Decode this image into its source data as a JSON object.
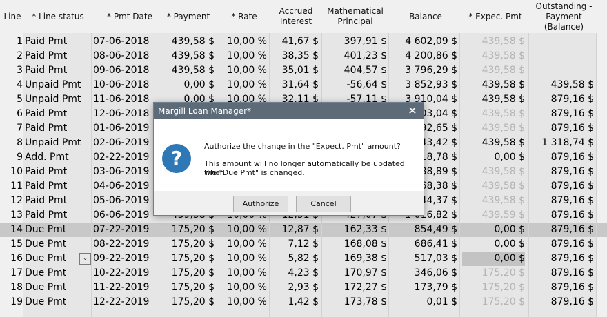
{
  "columns": [
    "Line",
    "* Line status",
    "* Pmt Date",
    "* Payment",
    "* Rate",
    "Accrued Interest",
    "Mathematical Principal",
    "Balance",
    "* Expec. Pmt",
    "Outstanding - Payment (Balance)"
  ],
  "rows": [
    {
      "line": "1",
      "status": "Paid Pmt",
      "date": "07-06-2018",
      "payment": "439,58 $",
      "rate": "10,00 %",
      "interest": "41,67 $",
      "principal": "397,91 $",
      "balance": "4 602,09 $",
      "expec": "439,58 $",
      "outstanding": ""
    },
    {
      "line": "2",
      "status": "Paid Pmt",
      "date": "08-06-2018",
      "payment": "439,58 $",
      "rate": "10,00 %",
      "interest": "38,35 $",
      "principal": "401,23 $",
      "balance": "4 200,86 $",
      "expec": "439,58 $",
      "outstanding": ""
    },
    {
      "line": "3",
      "status": "Paid Pmt",
      "date": "09-06-2018",
      "payment": "439,58 $",
      "rate": "10,00 %",
      "interest": "35,01 $",
      "principal": "404,57 $",
      "balance": "3 796,29 $",
      "expec": "439,58 $",
      "outstanding": ""
    },
    {
      "line": "4",
      "status": "Unpaid Pmt",
      "date": "10-06-2018",
      "payment": "0,00 $",
      "rate": "10,00 %",
      "interest": "31,64 $",
      "principal": "-56,64 $",
      "balance": "3 852,93 $",
      "expec": "439,58 $",
      "outstanding": "439,58 $"
    },
    {
      "line": "5",
      "status": "Unpaid Pmt",
      "date": "11-06-2018",
      "payment": "0,00 $",
      "rate": "10,00 %",
      "interest": "32,11 $",
      "principal": "-57,11 $",
      "balance": "3 910,04 $",
      "expec": "439,58 $",
      "outstanding": "879,16 $"
    },
    {
      "line": "6",
      "status": "Paid Pmt",
      "date": "12-06-2018",
      "payment": "",
      "rate": "",
      "interest": "",
      "principal": "",
      "balance": "503,04 $",
      "expec": "439,58 $",
      "outstanding": "879,16 $"
    },
    {
      "line": "7",
      "status": "Paid Pmt",
      "date": "01-06-2019",
      "payment": "",
      "rate": "",
      "interest": "",
      "principal": "",
      "balance": "092,65 $",
      "expec": "439,58 $",
      "outstanding": "879,16 $"
    },
    {
      "line": "8",
      "status": "Unpaid Pmt",
      "date": "02-06-2019",
      "payment": "",
      "rate": "",
      "interest": "",
      "principal": "",
      "balance": "43,42 $",
      "expec": "439,58 $",
      "outstanding": "1 318,74 $"
    },
    {
      "line": "9",
      "status": "Add. Pmt",
      "date": "02-22-2019",
      "payment": "",
      "rate": "",
      "interest": "",
      "principal": "",
      "balance": "718,78 $",
      "expec": "0,00 $",
      "outstanding": "879,16 $"
    },
    {
      "line": "10",
      "status": "Paid Pmt",
      "date": "03-06-2019",
      "payment": "",
      "rate": "",
      "interest": "",
      "principal": "",
      "balance": "288,89 $",
      "expec": "439,58 $",
      "outstanding": "879,16 $"
    },
    {
      "line": "11",
      "status": "Paid Pmt",
      "date": "04-06-2019",
      "payment": "",
      "rate": "",
      "interest": "",
      "principal": "",
      "balance": "868,38 $",
      "expec": "439,58 $",
      "outstanding": "879,16 $"
    },
    {
      "line": "12",
      "status": "Paid Pmt",
      "date": "05-06-2019",
      "payment": "",
      "rate": "",
      "interest": "",
      "principal": "",
      "balance": "444,37 $",
      "expec": "439,58 $",
      "outstanding": "879,16 $"
    },
    {
      "line": "13",
      "status": "Paid Pmt",
      "date": "06-06-2019",
      "payment": "439,58 $",
      "rate": "10,00 %",
      "interest": "12,51 $",
      "principal": "427,07 $",
      "balance": "1 016,82 $",
      "expec": "439,59 $",
      "outstanding": "879,16 $"
    },
    {
      "line": "14",
      "status": "Due Pmt",
      "date": "07-22-2019",
      "payment": "175,20 $",
      "rate": "10,00 %",
      "interest": "12,87 $",
      "principal": "162,33 $",
      "balance": "854,49 $",
      "expec": "0,00 $",
      "outstanding": "879,16 $"
    },
    {
      "line": "15",
      "status": "Due Pmt",
      "date": "08-22-2019",
      "payment": "175,20 $",
      "rate": "10,00 %",
      "interest": "7,12 $",
      "principal": "168,08 $",
      "balance": "686,41 $",
      "expec": "0,00 $",
      "outstanding": "879,16 $"
    },
    {
      "line": "16",
      "status": "Due Pmt",
      "date": "09-22-2019",
      "payment": "175,20 $",
      "rate": "10,00 %",
      "interest": "5,82 $",
      "principal": "169,38 $",
      "balance": "517,03 $",
      "expec": "0,00 $",
      "outstanding": "879,16 $"
    },
    {
      "line": "17",
      "status": "Due Pmt",
      "date": "10-22-2019",
      "payment": "175,20 $",
      "rate": "10,00 %",
      "interest": "4,23 $",
      "principal": "170,97 $",
      "balance": "346,06 $",
      "expec": "175,20 $",
      "outstanding": "879,16 $"
    },
    {
      "line": "18",
      "status": "Due Pmt",
      "date": "11-22-2019",
      "payment": "175,20 $",
      "rate": "10,00 %",
      "interest": "2,93 $",
      "principal": "172,27 $",
      "balance": "173,79 $",
      "expec": "175,20 $",
      "outstanding": "879,16 $"
    },
    {
      "line": "19",
      "status": "Due Pmt",
      "date": "12-22-2019",
      "payment": "175,20 $",
      "rate": "10,00 %",
      "interest": "1,42 $",
      "principal": "173,78 $",
      "balance": "0,01 $",
      "expec": "175,20 $",
      "outstanding": "879,16 $"
    }
  ],
  "dimmed_expec_lines": [
    "1",
    "2",
    "3",
    "6",
    "7",
    "10",
    "11",
    "12",
    "13",
    "17",
    "18",
    "19"
  ],
  "highlighted_row": "14",
  "active_line": "16",
  "dialog": {
    "title": "Margill Loan Manager*",
    "message_line1": "Authorize the change in the \"Expect. Pmt\" amount?",
    "message_line2": "This amount will no longer automatically be updated when",
    "message_line3": "the \"Due Pmt\" is changed.",
    "authorize_label": "Authorize",
    "cancel_label": "Cancel",
    "close_glyph": "✕",
    "icon_glyph": "?",
    "icon_color": "#2f78b6"
  },
  "combo_glyph": "⌄"
}
